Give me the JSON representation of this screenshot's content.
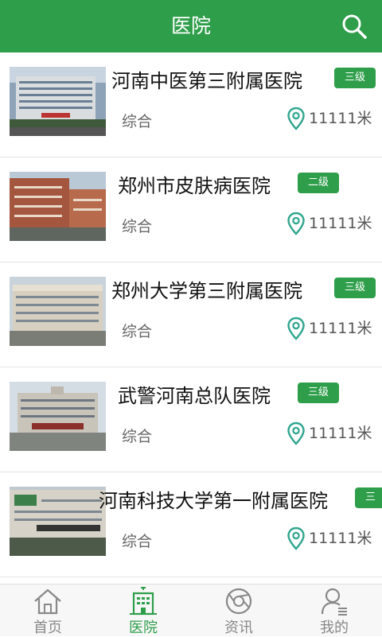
{
  "header": {
    "title": "医院",
    "search_icon": "search-icon"
  },
  "theme": {
    "accent": "#2e9e4a",
    "pin_color": "#2fa58e"
  },
  "hospitals": [
    {
      "name": "河南中医第三附属医院",
      "level": "三级",
      "type": "综合",
      "distance": "11111米"
    },
    {
      "name": "郑州市皮肤病医院",
      "level": "二级",
      "type": "综合",
      "distance": "11111米"
    },
    {
      "name": "郑州大学第三附属医院",
      "level": "三级",
      "type": "综合",
      "distance": "11111米"
    },
    {
      "name": "武警河南总队医院",
      "level": "三级",
      "type": "综合",
      "distance": "11111米"
    },
    {
      "name": "河南科技大学第一附属医院",
      "level": "三级",
      "type": "综合",
      "distance": "11111米"
    }
  ],
  "tabs": [
    {
      "label": "首页",
      "icon": "home-icon",
      "active": false
    },
    {
      "label": "医院",
      "icon": "hospital-icon",
      "active": true
    },
    {
      "label": "资讯",
      "icon": "news-icon",
      "active": false
    },
    {
      "label": "我的",
      "icon": "profile-icon",
      "active": false
    }
  ]
}
